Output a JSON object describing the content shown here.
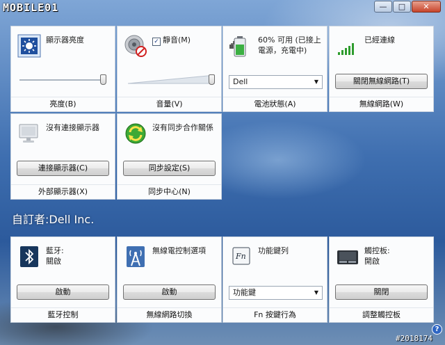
{
  "window": {
    "logo_text": "MOBILE01",
    "minimize_icon": "minimize-icon",
    "maximize_icon": "maximize-icon",
    "close_icon": "close-icon"
  },
  "tiles": {
    "brightness": {
      "title": "顯示器亮度",
      "footer": "亮度(B)",
      "icon": "monitor-brightness-icon",
      "level": 1.0
    },
    "volume": {
      "mute_label": "靜音(M)",
      "mute_checked": true,
      "footer": "音量(V)",
      "icon": "speaker-muted-icon",
      "level": 1.0
    },
    "battery": {
      "title": "60% 可用 (已接上電源，充電中)",
      "select_value": "Dell",
      "footer": "電池狀態(A)",
      "icon": "battery-charging-icon"
    },
    "wireless": {
      "title": "已經連線",
      "button": "關閉無線網路(T)",
      "footer": "無線網路(W)",
      "icon": "signal-bars-icon"
    },
    "display": {
      "title": "沒有連接顯示器",
      "button": "連接顯示器(C)",
      "footer": "外部顯示器(X)",
      "icon": "external-monitor-icon"
    },
    "sync": {
      "title": "沒有同步合作關係",
      "button": "同步設定(S)",
      "footer": "同步中心(N)",
      "icon": "sync-icon"
    },
    "bluetooth": {
      "title": "藍牙:",
      "status": "關啟",
      "button": "啟動",
      "footer": "藍牙控制",
      "icon": "bluetooth-icon"
    },
    "wireless_switch": {
      "title": "無線電控制選項",
      "button": "啟動",
      "footer": "無線網路切換",
      "icon": "antenna-icon"
    },
    "fn": {
      "title": "功能鍵列",
      "select_value": "功能鍵",
      "footer": "Fn 按鍵行為",
      "icon": "fn-key-icon"
    },
    "touchpad": {
      "title": "觸控板:",
      "status": "開啟",
      "button": "關閉",
      "footer": "調整觸控板",
      "icon": "touchpad-icon"
    }
  },
  "custom_label": "自訂者:Dell Inc.",
  "watermark": "#2018174",
  "help_icon": "help-icon"
}
